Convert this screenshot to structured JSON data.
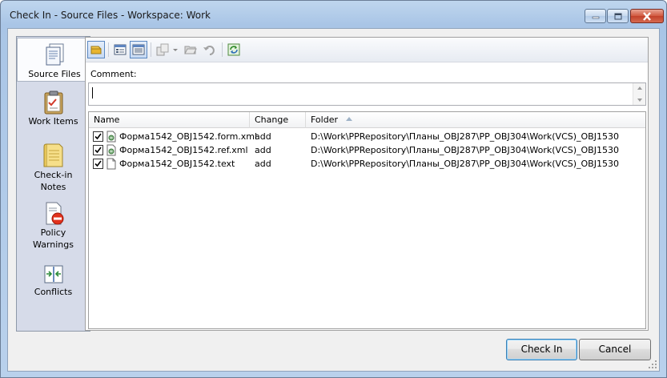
{
  "window": {
    "title": "Check In - Source Files - Workspace: Work"
  },
  "nav": {
    "items": [
      {
        "label": "Source Files",
        "icon": "source-files-icon",
        "active": true
      },
      {
        "label": "Work Items",
        "icon": "work-items-icon",
        "active": false
      },
      {
        "label": "Check-in Notes",
        "icon": "check-in-notes-icon",
        "active": false
      },
      {
        "label": "Policy Warnings",
        "icon": "policy-warnings-icon",
        "active": false
      },
      {
        "label": "Conflicts",
        "icon": "conflicts-icon",
        "active": false
      }
    ]
  },
  "toolbar": {
    "buttons": [
      {
        "icon": "shelve-icon",
        "pressed": true
      },
      {
        "icon": "flat-view-icon",
        "pressed": false
      },
      {
        "icon": "tree-view-icon",
        "pressed": true
      },
      {
        "icon": "compare-icon",
        "pressed": false,
        "disabled": true
      },
      {
        "icon": "open-folder-icon",
        "pressed": false,
        "disabled": true
      },
      {
        "icon": "undo-icon",
        "pressed": false,
        "disabled": true
      },
      {
        "icon": "refresh-icon",
        "pressed": false
      }
    ]
  },
  "comment": {
    "label": "Comment:",
    "value": ""
  },
  "grid": {
    "columns": [
      "Name",
      "Change",
      "Folder"
    ],
    "sort_column": "Folder",
    "rows": [
      {
        "checked": true,
        "name": "Форма1542_OBJ1542.form.xml",
        "change": "add",
        "folder": "D:\\Work\\PPRepository\\Планы_OBJ287\\PP_OBJ304\\Work(VCS)_OBJ1530",
        "icon": "xml-file-icon"
      },
      {
        "checked": true,
        "name": "Форма1542_OBJ1542.ref.xml",
        "change": "add",
        "folder": "D:\\Work\\PPRepository\\Планы_OBJ287\\PP_OBJ304\\Work(VCS)_OBJ1530",
        "icon": "xml-file-icon"
      },
      {
        "checked": true,
        "name": "Форма1542_OBJ1542.text",
        "change": "add",
        "folder": "D:\\Work\\PPRepository\\Планы_OBJ287\\PP_OBJ304\\Work(VCS)_OBJ1530",
        "icon": "text-file-icon"
      }
    ]
  },
  "buttons": {
    "check_in": "Check In",
    "cancel": "Cancel"
  },
  "colors": {
    "frame": "#b9d1ec",
    "nav_bg": "#d6dbe9",
    "close_button": "#c2412a"
  }
}
